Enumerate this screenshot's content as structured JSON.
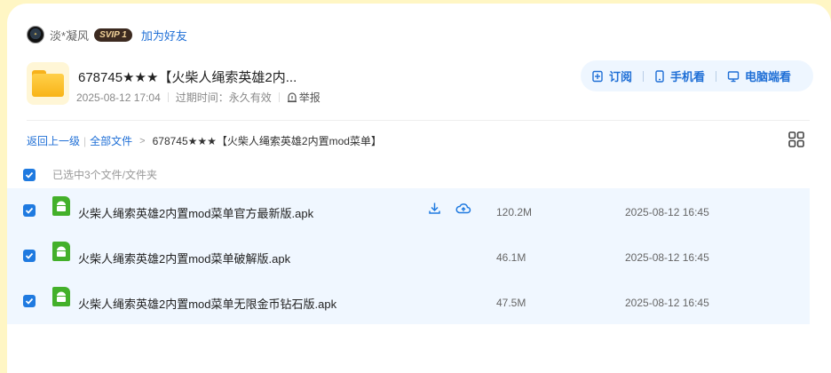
{
  "user": {
    "name": "淡*凝风",
    "vip": "SVIP 1",
    "add_friend": "加为好友"
  },
  "folder": {
    "title": "678745★★★【火柴人绳索英雄2内...",
    "date": "2025-08-12 17:04",
    "expire": "过期时间：永久有效",
    "report": "举报"
  },
  "actions": {
    "subscribe": "订阅",
    "mobile": "手机看",
    "pc": "电脑端看"
  },
  "breadcrumb": {
    "back": "返回上一级",
    "all_files": "全部文件",
    "current": "678745★★★【火柴人绳索英雄2内置mod菜单】"
  },
  "selection": {
    "text": "已选中3个文件/文件夹"
  },
  "colors": {
    "accent": "#1f6fd6",
    "row_bg": "#f0f7ff",
    "checkbox": "#1f7ae0",
    "apk": "#43b02a",
    "page_bg": "#fff6c4"
  },
  "files": [
    {
      "name": "火柴人绳索英雄2内置mod菜单官方最新版.apk",
      "size": "120.2M",
      "date": "2025-08-12 16:45",
      "icon": "android-icon"
    },
    {
      "name": "火柴人绳索英雄2内置mod菜单破解版.apk",
      "size": "46.1M",
      "date": "2025-08-12 16:45",
      "icon": "android-icon"
    },
    {
      "name": "火柴人绳索英雄2内置mod菜单无限金币钻石版.apk",
      "size": "47.5M",
      "date": "2025-08-12 16:45",
      "icon": "android-icon"
    }
  ]
}
